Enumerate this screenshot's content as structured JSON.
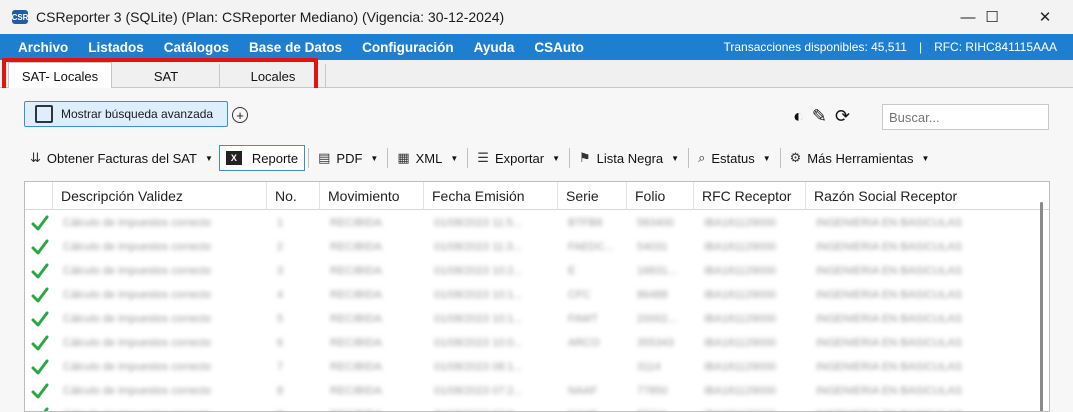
{
  "window": {
    "title": "CSReporter 3 (SQLite) (Plan: CSReporter Mediano) (Vigencia: 30-12-2024)",
    "app_icon_text": "CSR",
    "controls": {
      "minimize": "—",
      "maximize": "☐",
      "close": "✕"
    }
  },
  "menu": {
    "items": [
      "Archivo",
      "Listados",
      "Catálogos",
      "Base de Datos",
      "Configuración",
      "Ayuda",
      "CSAuto"
    ],
    "transactions": "Transacciones disponibles: 45,511",
    "separator": "|",
    "rfc": "RFC: RIHC841115AAA"
  },
  "tabs": [
    "SAT- Locales",
    "SAT",
    "Locales"
  ],
  "accent_colors": {
    "menubar": "#1e7fd0",
    "highlight_box": "#e11414",
    "check": "#2aa845"
  },
  "advanced_search": {
    "label": "Mostrar búsqueda avanzada"
  },
  "search": {
    "placeholder": "Buscar..."
  },
  "toolbar": {
    "obtener": "Obtener Facturas del SAT",
    "reporte": "Reporte",
    "pdf": "PDF",
    "xml": "XML",
    "exportar": "Exportar",
    "lista_negra": "Lista Negra",
    "estatus": "Estatus",
    "mas": "Más Herramientas"
  },
  "grid": {
    "columns": [
      "Descripción Validez",
      "No.",
      "Movimiento",
      "Fecha Emisión",
      "Serie",
      "Folio",
      "RFC Receptor",
      "Razón Social Receptor"
    ],
    "rows": [
      {
        "desc": "Cálculo de impuestos correcto",
        "no": "1",
        "mov": "RECIBIDA",
        "fecha": "01/08/2023 11:5...",
        "serie": "BTFB8",
        "folio": "583400",
        "rfc": "IBA181129000",
        "razon": "INGENIERIA EN BASICULAS"
      },
      {
        "desc": "Cálculo de impuestos correcto",
        "no": "2",
        "mov": "RECIBIDA",
        "fecha": "01/08/2023 11:3...",
        "serie": "FAEDC...",
        "folio": "54031",
        "rfc": "IBA181129000",
        "razon": "INGENIERIA EN BASICULAS"
      },
      {
        "desc": "Cálculo de impuestos correcto",
        "no": "3",
        "mov": "RECIBIDA",
        "fecha": "01/08/2023 10:2...",
        "serie": "E",
        "folio": "16831...",
        "rfc": "IBA181129000",
        "razon": "INGENIERIA EN BASICULAS"
      },
      {
        "desc": "Cálculo de impuestos correcto",
        "no": "4",
        "mov": "RECIBIDA",
        "fecha": "01/08/2023 10:1...",
        "serie": "CFC",
        "folio": "86488",
        "rfc": "IBA181129000",
        "razon": "INGENIERIA EN BASICULAS"
      },
      {
        "desc": "Cálculo de impuestos correcto",
        "no": "5",
        "mov": "RECIBIDA",
        "fecha": "01/08/2023 10:1...",
        "serie": "FAWT",
        "folio": "20002...",
        "rfc": "IBA181129000",
        "razon": "INGENIERIA EN BASICULAS"
      },
      {
        "desc": "Cálculo de impuestos correcto",
        "no": "6",
        "mov": "RECIBIDA",
        "fecha": "01/08/2023 10:0...",
        "serie": "ARCO",
        "folio": "355343",
        "rfc": "IBA181129000",
        "razon": "INGENIERIA EN BASICULAS"
      },
      {
        "desc": "Cálculo de impuestos correcto",
        "no": "7",
        "mov": "RECIBIDA",
        "fecha": "01/08/2023 08:1...",
        "serie": "",
        "folio": "3114",
        "rfc": "IBA181129000",
        "razon": "INGENIERIA EN BASICULAS"
      },
      {
        "desc": "Cálculo de impuestos correcto",
        "no": "8",
        "mov": "RECIBIDA",
        "fecha": "01/08/2023 07:2...",
        "serie": "NAAF",
        "folio": "77850",
        "rfc": "IBA181129000",
        "razon": "INGENIERIA EN BASICULAS"
      },
      {
        "desc": "Cálculo de impuestos correcto",
        "no": "9",
        "mov": "RECIBIDA",
        "fecha": "01/08/2023 07:0...",
        "serie": "NAAF",
        "folio": "77211",
        "rfc": "IBA181129000",
        "razon": "INGENIERIA EN BASICULAS"
      }
    ]
  }
}
